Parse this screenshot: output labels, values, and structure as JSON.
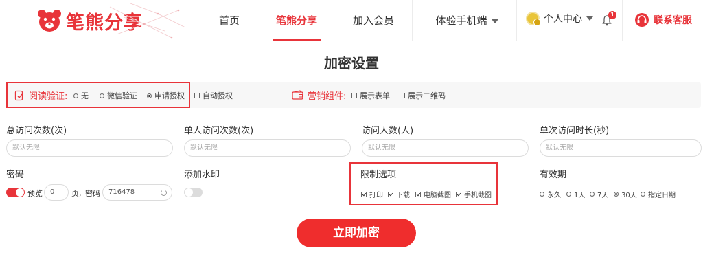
{
  "logo": {
    "text": "笔熊分享"
  },
  "nav": {
    "items": [
      {
        "label": "首页"
      },
      {
        "label": "笔熊分享"
      },
      {
        "label": "加入会员"
      },
      {
        "label": "体验手机端"
      }
    ],
    "user_center": "个人中心",
    "notification_count": "1",
    "service": "联系客服"
  },
  "page_title": "加密设置",
  "read_verify": {
    "label": "阅读验证:",
    "options": [
      "无",
      "微信验证",
      "申请授权"
    ],
    "selected": "申请授权",
    "auto_auth": "自动授权"
  },
  "marketing": {
    "label": "营销组件:",
    "options": [
      "展示表单",
      "展示二维码"
    ]
  },
  "fields": {
    "total_visits": {
      "label": "总访问次数(次)",
      "placeholder": "默认无限"
    },
    "per_user_visits": {
      "label": "单人访问次数(次)",
      "placeholder": "默认无限"
    },
    "visitors": {
      "label": "访问人数(人)",
      "placeholder": "默认无限"
    },
    "duration": {
      "label": "单次访问时长(秒)",
      "placeholder": "默认无限"
    }
  },
  "password": {
    "label": "密码",
    "preview": "预览",
    "preview_pages": "0",
    "page_unit": "页,",
    "pwd_label": "密码",
    "pwd_value": "716478"
  },
  "watermark": {
    "label": "添加水印"
  },
  "restrictions": {
    "label": "限制选项",
    "options": [
      "打印",
      "下载",
      "电脑截图",
      "手机截图"
    ]
  },
  "validity": {
    "label": "有效期",
    "options": [
      "永久",
      "1天",
      "7天",
      "30天",
      "指定日期"
    ],
    "selected": "30天"
  },
  "submit_label": "立即加密",
  "colors": {
    "accent": "#e8343a",
    "button": "#ef2d2d"
  }
}
